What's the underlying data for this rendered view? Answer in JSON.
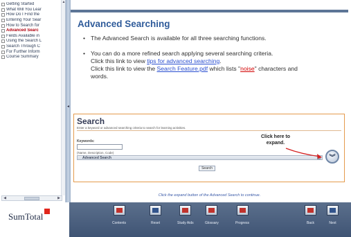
{
  "toc": {
    "items": [
      {
        "label": "Getting Started",
        "active": false
      },
      {
        "label": "What Will You Lear",
        "active": false
      },
      {
        "label": "How Do I Find the",
        "active": false
      },
      {
        "label": "Entering Your Sear",
        "active": false
      },
      {
        "label": "How to Search for",
        "active": false
      },
      {
        "label": "Advanced Searc",
        "active": true
      },
      {
        "label": "Fields Available in",
        "active": false
      },
      {
        "label": "Using the Search L",
        "active": false
      },
      {
        "label": "Search Through C",
        "active": false
      },
      {
        "label": "For Further Inform",
        "active": false
      },
      {
        "label": "Course Summary",
        "active": false
      }
    ]
  },
  "main": {
    "title": "Advanced Searching",
    "bullet1": "The Advanced Search is available for all three searching functions.",
    "bullet2": {
      "line1": "You can do a more refined search applying several searching criteria.",
      "line2_prefix": "Click this link to view ",
      "line2_link": "tips for advanced searching",
      "line2_suffix": ".",
      "line3_prefix": "Click this link to view the ",
      "line3_link": "Search Feature.pdf",
      "line3_mid": " which lists \"",
      "line3_noise": "noise",
      "line3_suffix": "\" characters and",
      "line4": "words."
    },
    "footer_note": "Click the expand button of the Advanced Search to continue."
  },
  "search": {
    "title": "Search",
    "instruction": "Enter a keyword or advanced searching criteria to search for learning activities.",
    "keywords_label": "Keywords:",
    "keywords_value": "",
    "keywords_hint": "(Name, Description, Code)",
    "advanced_label": "Advanced Search",
    "button_label": "Search",
    "callout_line1": "Click here to",
    "callout_line2": "expand."
  },
  "bottom": {
    "logo_text": "SumTotal",
    "nav": [
      {
        "label": "Contents",
        "icon": "contents-icon"
      },
      {
        "label": "Reset",
        "icon": "reset-icon"
      },
      {
        "label": "Study Aids",
        "icon": "study-aids-icon"
      },
      {
        "label": "Glossary",
        "icon": "glossary-icon"
      },
      {
        "label": "Progress",
        "icon": "progress-icon"
      },
      {
        "label": "Back",
        "icon": "back-icon"
      },
      {
        "label": "Next",
        "icon": "next-icon"
      }
    ]
  },
  "colors": {
    "title": "#2f5b9a",
    "active_toc": "#b0000e",
    "search_border": "#e49a4c",
    "navbar": "#4a5f80",
    "logo_accent": "#e1261c"
  }
}
